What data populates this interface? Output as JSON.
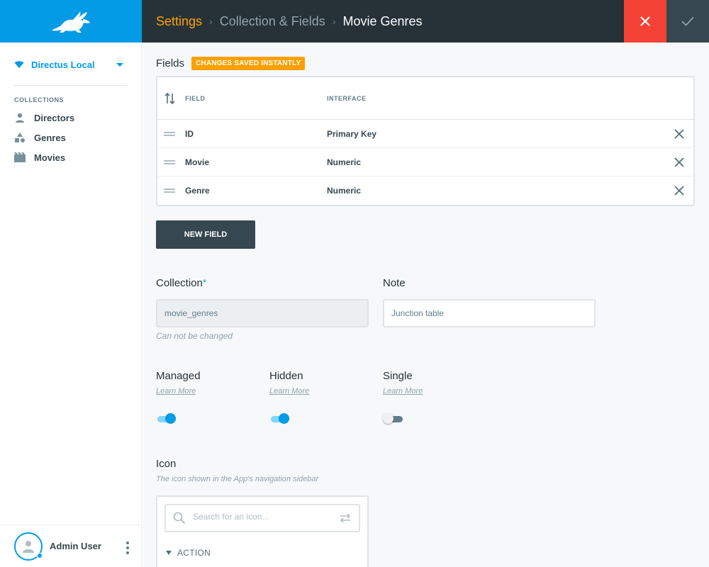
{
  "sidebar": {
    "project": "Directus Local",
    "section_label": "COLLECTIONS",
    "items": [
      {
        "label": "Directors",
        "icon": "person-icon"
      },
      {
        "label": "Genres",
        "icon": "shapes-icon"
      },
      {
        "label": "Movies",
        "icon": "movie-icon"
      }
    ],
    "user": "Admin User"
  },
  "header": {
    "crumbs": [
      "Settings",
      "Collection & Fields",
      "Movie Genres"
    ]
  },
  "fields": {
    "title": "Fields",
    "badge": "CHANGES SAVED INSTANTLY",
    "columns": [
      "FIELD",
      "INTERFACE"
    ],
    "rows": [
      {
        "field": "ID",
        "interface": "Primary Key"
      },
      {
        "field": "Movie",
        "interface": "Numeric"
      },
      {
        "field": "Genre",
        "interface": "Numeric"
      }
    ],
    "new_field_label": "NEW FIELD"
  },
  "form": {
    "collection_label": "Collection",
    "collection_required": "*",
    "collection_value": "movie_genres",
    "collection_helper": "Can not be changed",
    "note_label": "Note",
    "note_value": "Junction table",
    "managed_label": "Managed",
    "managed_on": true,
    "hidden_label": "Hidden",
    "hidden_on": true,
    "single_label": "Single",
    "single_on": false,
    "learn_more": "Learn More",
    "icon_label": "Icon",
    "icon_helper": "The icon shown in the App's navigation sidebar",
    "icon_search_placeholder": "Search for an icon...",
    "icon_group": "ACTION"
  },
  "colors": {
    "accent": "#039be5",
    "header_bg": "#263238",
    "breadcrumb_active": "#ffa000",
    "close_button": "#f44336",
    "badge": "#ffa000"
  }
}
